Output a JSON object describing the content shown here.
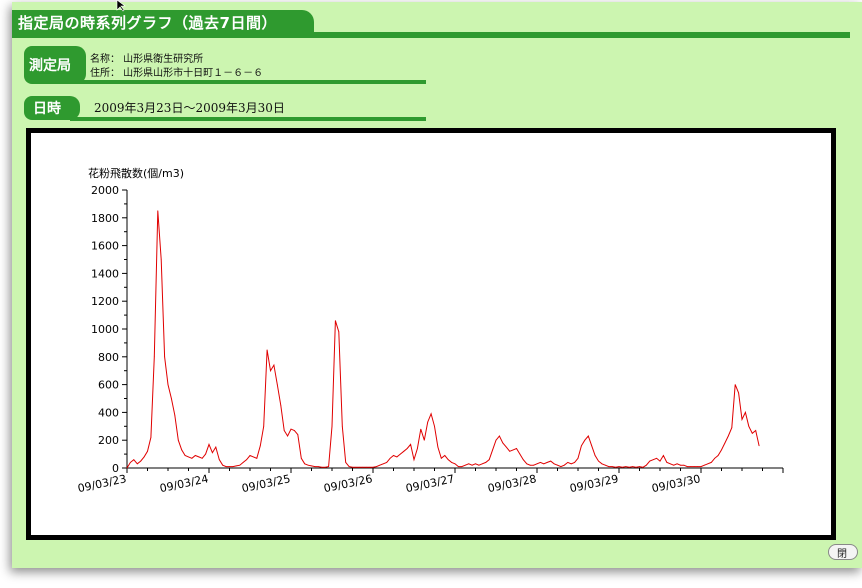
{
  "header": {
    "title": "指定局の時系列グラフ（過去7日間）"
  },
  "station": {
    "label": "測定局",
    "name_line": "名称： 山形県衛生研究所",
    "address_line": "住所： 山形県山形市十日町１－６－６"
  },
  "period": {
    "label": "日時",
    "range": "2009年3月23日〜2009年3月30日"
  },
  "close_button": {
    "label": "閉"
  },
  "colors": {
    "accent": "#2f9a2f",
    "background": "#ccf5b0",
    "series": "#e00000"
  },
  "chart_data": {
    "type": "line",
    "ylabel": "花粉飛散数(個/m3)",
    "ylim": [
      0,
      2000
    ],
    "ytick_labels": [
      "0",
      "200",
      "400",
      "600",
      "800",
      "1000",
      "1200",
      "1400",
      "1600",
      "1800",
      "2000"
    ],
    "x_tick_labels": [
      "09/03/23",
      "09/03/24",
      "09/03/25",
      "09/03/26",
      "09/03/27",
      "09/03/28",
      "09/03/29",
      "09/03/30"
    ],
    "x_unit": "hour index from 09/03/23 00:00",
    "xlim": [
      0,
      192
    ],
    "series": [
      {
        "values": [
          [
            0,
            0
          ],
          [
            1,
            40
          ],
          [
            2,
            60
          ],
          [
            3,
            30
          ],
          [
            4,
            50
          ],
          [
            5,
            80
          ],
          [
            6,
            120
          ],
          [
            7,
            220
          ],
          [
            8,
            800
          ],
          [
            9,
            1850
          ],
          [
            10,
            1500
          ],
          [
            11,
            800
          ],
          [
            12,
            600
          ],
          [
            13,
            500
          ],
          [
            14,
            380
          ],
          [
            15,
            200
          ],
          [
            16,
            130
          ],
          [
            17,
            90
          ],
          [
            18,
            80
          ],
          [
            19,
            70
          ],
          [
            20,
            90
          ],
          [
            21,
            80
          ],
          [
            22,
            70
          ],
          [
            23,
            100
          ],
          [
            24,
            170
          ],
          [
            25,
            110
          ],
          [
            26,
            150
          ],
          [
            27,
            60
          ],
          [
            28,
            20
          ],
          [
            29,
            10
          ],
          [
            30,
            10
          ],
          [
            31,
            10
          ],
          [
            32,
            15
          ],
          [
            33,
            20
          ],
          [
            34,
            40
          ],
          [
            35,
            60
          ],
          [
            36,
            90
          ],
          [
            37,
            80
          ],
          [
            38,
            70
          ],
          [
            39,
            160
          ],
          [
            40,
            300
          ],
          [
            41,
            850
          ],
          [
            42,
            700
          ],
          [
            43,
            740
          ],
          [
            44,
            600
          ],
          [
            45,
            450
          ],
          [
            46,
            270
          ],
          [
            47,
            230
          ],
          [
            48,
            280
          ],
          [
            49,
            270
          ],
          [
            50,
            240
          ],
          [
            51,
            70
          ],
          [
            52,
            30
          ],
          [
            53,
            20
          ],
          [
            54,
            15
          ],
          [
            55,
            10
          ],
          [
            56,
            10
          ],
          [
            57,
            5
          ],
          [
            58,
            5
          ],
          [
            59,
            10
          ],
          [
            60,
            300
          ],
          [
            61,
            1060
          ],
          [
            62,
            980
          ],
          [
            63,
            300
          ],
          [
            64,
            40
          ],
          [
            65,
            10
          ],
          [
            66,
            5
          ],
          [
            67,
            5
          ],
          [
            68,
            5
          ],
          [
            69,
            5
          ],
          [
            70,
            5
          ],
          [
            71,
            5
          ],
          [
            72,
            5
          ],
          [
            73,
            10
          ],
          [
            74,
            20
          ],
          [
            75,
            30
          ],
          [
            76,
            40
          ],
          [
            77,
            70
          ],
          [
            78,
            90
          ],
          [
            79,
            80
          ],
          [
            80,
            100
          ],
          [
            81,
            120
          ],
          [
            82,
            140
          ],
          [
            83,
            170
          ],
          [
            84,
            60
          ],
          [
            85,
            140
          ],
          [
            86,
            280
          ],
          [
            87,
            200
          ],
          [
            88,
            330
          ],
          [
            89,
            390
          ],
          [
            90,
            300
          ],
          [
            91,
            150
          ],
          [
            92,
            70
          ],
          [
            93,
            90
          ],
          [
            94,
            60
          ],
          [
            95,
            40
          ],
          [
            96,
            30
          ],
          [
            97,
            10
          ],
          [
            98,
            10
          ],
          [
            99,
            20
          ],
          [
            100,
            30
          ],
          [
            101,
            20
          ],
          [
            102,
            30
          ],
          [
            103,
            20
          ],
          [
            104,
            30
          ],
          [
            105,
            40
          ],
          [
            106,
            60
          ],
          [
            107,
            130
          ],
          [
            108,
            200
          ],
          [
            109,
            230
          ],
          [
            110,
            180
          ],
          [
            111,
            150
          ],
          [
            112,
            120
          ],
          [
            113,
            130
          ],
          [
            114,
            140
          ],
          [
            115,
            100
          ],
          [
            116,
            60
          ],
          [
            117,
            30
          ],
          [
            118,
            20
          ],
          [
            119,
            20
          ],
          [
            120,
            30
          ],
          [
            121,
            40
          ],
          [
            122,
            30
          ],
          [
            123,
            40
          ],
          [
            124,
            50
          ],
          [
            125,
            30
          ],
          [
            126,
            20
          ],
          [
            127,
            10
          ],
          [
            128,
            20
          ],
          [
            129,
            40
          ],
          [
            130,
            30
          ],
          [
            131,
            40
          ],
          [
            132,
            70
          ],
          [
            133,
            160
          ],
          [
            134,
            200
          ],
          [
            135,
            230
          ],
          [
            136,
            160
          ],
          [
            137,
            90
          ],
          [
            138,
            50
          ],
          [
            139,
            30
          ],
          [
            140,
            20
          ],
          [
            141,
            10
          ],
          [
            142,
            10
          ],
          [
            143,
            5
          ],
          [
            144,
            10
          ],
          [
            145,
            5
          ],
          [
            146,
            10
          ],
          [
            147,
            5
          ],
          [
            148,
            10
          ],
          [
            149,
            5
          ],
          [
            150,
            10
          ],
          [
            151,
            5
          ],
          [
            152,
            20
          ],
          [
            153,
            50
          ],
          [
            154,
            60
          ],
          [
            155,
            70
          ],
          [
            156,
            50
          ],
          [
            157,
            90
          ],
          [
            158,
            40
          ],
          [
            159,
            30
          ],
          [
            160,
            20
          ],
          [
            161,
            30
          ],
          [
            162,
            20
          ],
          [
            163,
            20
          ],
          [
            164,
            10
          ],
          [
            165,
            10
          ],
          [
            166,
            10
          ],
          [
            167,
            10
          ],
          [
            168,
            10
          ],
          [
            169,
            20
          ],
          [
            170,
            30
          ],
          [
            171,
            40
          ],
          [
            172,
            70
          ],
          [
            173,
            90
          ],
          [
            174,
            130
          ],
          [
            175,
            180
          ],
          [
            176,
            230
          ],
          [
            177,
            290
          ],
          [
            178,
            600
          ],
          [
            179,
            540
          ],
          [
            180,
            350
          ],
          [
            181,
            400
          ],
          [
            182,
            300
          ],
          [
            183,
            250
          ],
          [
            184,
            270
          ],
          [
            185,
            160
          ]
        ]
      }
    ]
  }
}
